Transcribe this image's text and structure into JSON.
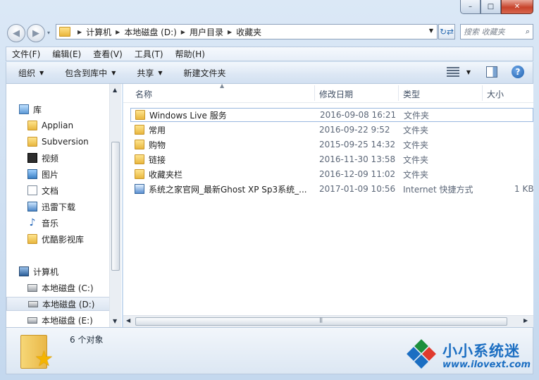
{
  "window": {
    "minimize": "–",
    "maximize": "□",
    "close": "✕"
  },
  "nav": {
    "back": "◀",
    "forward": "▶",
    "history_dropdown": "▾",
    "breadcrumbs": [
      "计算机",
      "本地磁盘 (D:)",
      "用户目录",
      "收藏夹"
    ],
    "refresh": "↻⇄",
    "search_placeholder": "搜索 收藏夹"
  },
  "menubar": [
    "文件(F)",
    "编辑(E)",
    "查看(V)",
    "工具(T)",
    "帮助(H)"
  ],
  "toolbar": {
    "organize": "组织",
    "include_in_library": "包含到库中",
    "share": "共享",
    "new_folder": "新建文件夹",
    "help": "?"
  },
  "navpane": {
    "library": {
      "label": "库",
      "icon": "library-icon"
    },
    "library_items": [
      {
        "label": "Applian",
        "icon": "folder-icon"
      },
      {
        "label": "Subversion",
        "icon": "folder-icon"
      },
      {
        "label": "视频",
        "icon": "video-icon"
      },
      {
        "label": "图片",
        "icon": "picture-icon"
      },
      {
        "label": "文档",
        "icon": "document-icon"
      },
      {
        "label": "迅雷下载",
        "icon": "download-icon"
      },
      {
        "label": "音乐",
        "icon": "music-icon"
      },
      {
        "label": "优酷影视库",
        "icon": "folder-icon"
      }
    ],
    "computer": {
      "label": "计算机",
      "icon": "computer-icon"
    },
    "drives": [
      {
        "label": "本地磁盘 (C:)",
        "selected": false
      },
      {
        "label": "本地磁盘 (D:)",
        "selected": true
      },
      {
        "label": "本地磁盘 (E:)",
        "selected": false
      }
    ]
  },
  "columns": {
    "name": "名称",
    "date": "修改日期",
    "type": "类型",
    "size": "大小"
  },
  "files": [
    {
      "name": "Windows Live 服务",
      "date": "2016-09-08 16:21",
      "type": "文件夹",
      "size": "",
      "icon": "folder-icon"
    },
    {
      "name": "常用",
      "date": "2016-09-22 9:52",
      "type": "文件夹",
      "size": "",
      "icon": "folder-icon"
    },
    {
      "name": "购物",
      "date": "2015-09-25 14:32",
      "type": "文件夹",
      "size": "",
      "icon": "folder-icon"
    },
    {
      "name": "链接",
      "date": "2016-11-30 13:58",
      "type": "文件夹",
      "size": "",
      "icon": "folder-icon"
    },
    {
      "name": "收藏夹栏",
      "date": "2016-12-09 11:02",
      "type": "文件夹",
      "size": "",
      "icon": "folder-icon"
    },
    {
      "name": "系统之家官网_最新Ghost XP Sp3系统_...",
      "date": "2017-01-09 10:56",
      "type": "Internet 快捷方式",
      "size": "1 KB",
      "icon": "internet-shortcut-icon"
    }
  ],
  "details": {
    "count_text": "6 个对象"
  },
  "watermark": {
    "title": "小小系统迷",
    "url": "www.ilovext.com"
  }
}
